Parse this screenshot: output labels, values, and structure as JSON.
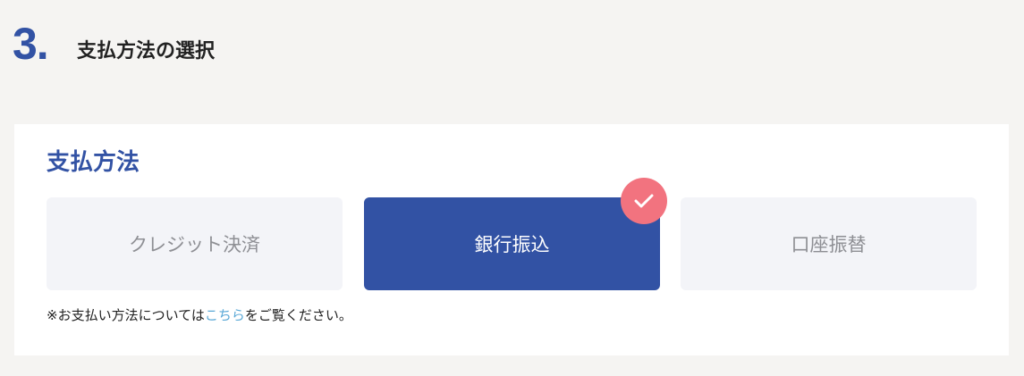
{
  "header": {
    "step_number": "3.",
    "title": "支払方法の選択"
  },
  "payment": {
    "title": "支払方法",
    "options": [
      {
        "label": "クレジット決済",
        "selected": false
      },
      {
        "label": "銀行振込",
        "selected": true
      },
      {
        "label": "口座振替",
        "selected": false
      }
    ],
    "note": {
      "prefix": "※お支払い方法については",
      "link_text": "こちら",
      "suffix": "をご覧ください。"
    }
  },
  "icons": {
    "selected_check": "checkmark-icon"
  },
  "colors": {
    "accent": "#3252a4",
    "badge": "#f2737f",
    "link": "#5aa8d6",
    "background": "#f5f4f2",
    "option_inactive": "#f3f4f8"
  }
}
